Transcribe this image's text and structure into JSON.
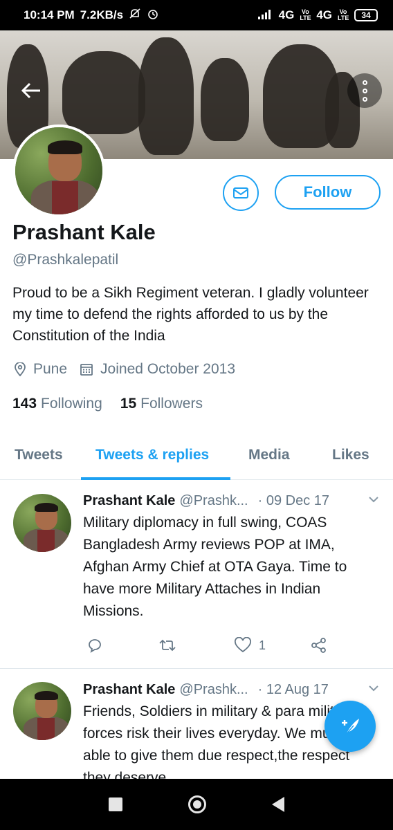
{
  "status_bar": {
    "time": "10:14 PM",
    "speed": "7.2KB/s",
    "network_1": "4G",
    "volte_1": "Vo LTE",
    "network_2": "4G",
    "volte_2": "Vo LTE",
    "battery": "34"
  },
  "profile": {
    "name": "Prashant Kale",
    "handle": "@Prashkalepatil",
    "bio": "Proud to be a Sikh Regiment veteran. I gladly volunteer my time to defend the rights afforded to us by the Constitution of the India",
    "location": "Pune",
    "joined": "Joined October 2013",
    "following_count": "143",
    "following_label": "Following",
    "followers_count": "15",
    "followers_label": "Followers",
    "follow_label": "Follow"
  },
  "tabs": [
    {
      "label": "Tweets",
      "active": false
    },
    {
      "label": "Tweets & replies",
      "active": true
    },
    {
      "label": "Media",
      "active": false
    },
    {
      "label": "Likes",
      "active": false
    }
  ],
  "tweets": [
    {
      "name": "Prashant Kale",
      "handle": "@Prashk...",
      "date": "· 09 Dec 17",
      "text": "Military diplomacy in full swing, COAS Bangladesh Army reviews POP at IMA, Afghan Army Chief at OTA Gaya. Time to have more Military Attaches in Indian Missions.",
      "like_count": "1"
    },
    {
      "name": "Prashant Kale",
      "handle": "@Prashk...",
      "date": "· 12 Aug 17",
      "text": "Friends, Soldiers in military & para military forces risk their lives everyday. We must be able to give them due respect,the respect they deserve"
    }
  ],
  "colors": {
    "accent": "#1da1f2",
    "text": "#14171a",
    "muted": "#657786"
  }
}
